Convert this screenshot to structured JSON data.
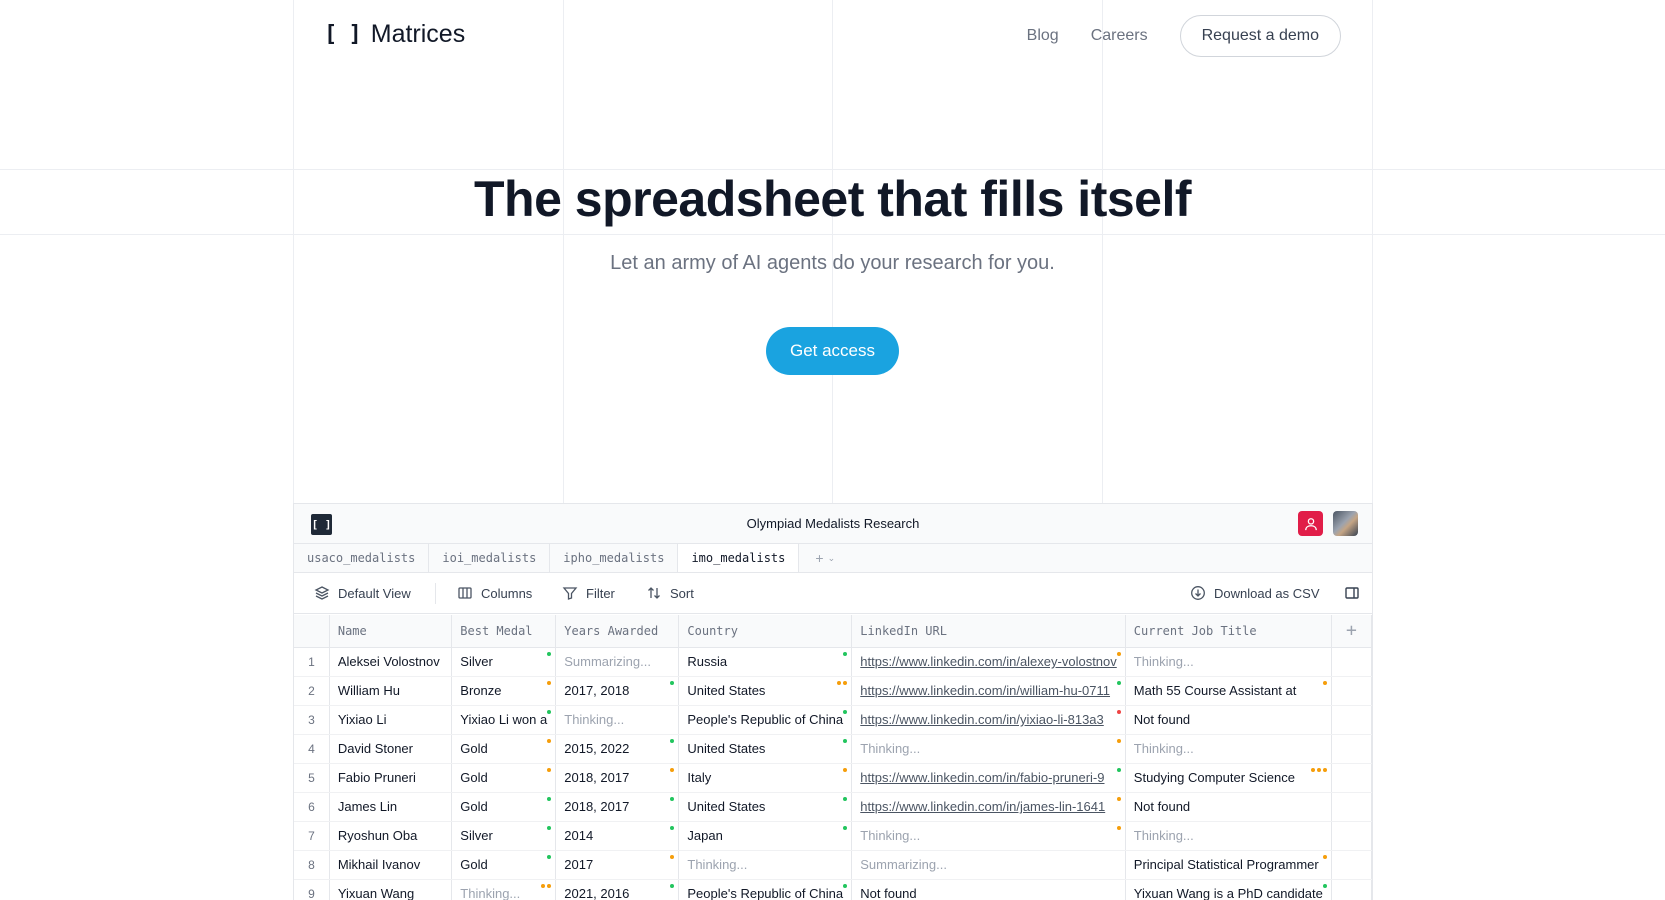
{
  "header": {
    "logo_mark": "[ ]",
    "logo_text": "Matrices",
    "nav": [
      {
        "label": "Blog"
      },
      {
        "label": "Careers"
      }
    ],
    "demo_label": "Request a demo"
  },
  "hero": {
    "title": "The spreadsheet that fills itself",
    "subtitle": "Let an army of AI agents do your research for you.",
    "cta_label": "Get access"
  },
  "app": {
    "logo_mark": "[ ]",
    "title": "Olympiad Medalists Research",
    "tabs": [
      {
        "label": "usaco_medalists"
      },
      {
        "label": "ioi_medalists"
      },
      {
        "label": "ipho_medalists"
      },
      {
        "label": "imo_medalists"
      }
    ],
    "toolbar": {
      "view_label": "Default View",
      "columns_label": "Columns",
      "filter_label": "Filter",
      "sort_label": "Sort",
      "download_label": "Download as CSV"
    },
    "columns": [
      "Name",
      "Best Medal",
      "Years Awarded",
      "Country",
      "LinkedIn URL",
      "Current Job Title"
    ],
    "rows": [
      {
        "idx": "1",
        "cells": [
          "Aleksei Volostnov",
          "Silver",
          "Summarizing...",
          "Russia",
          "https://www.linkedin.com/in/alexey-volostnov",
          "Thinking..."
        ]
      },
      {
        "idx": "2",
        "cells": [
          "William Hu",
          "Bronze",
          "2017, 2018",
          "United States",
          "https://www.linkedin.com/in/william-hu-0711",
          "Math 55 Course Assistant at"
        ]
      },
      {
        "idx": "3",
        "cells": [
          "Yixiao Li",
          "Yixiao Li won a",
          "Thinking...",
          "People's Republic of China",
          "https://www.linkedin.com/in/yixiao-li-813a3",
          "Not found"
        ]
      },
      {
        "idx": "4",
        "cells": [
          "David Stoner",
          "Gold",
          "2015, 2022",
          "United States",
          "Thinking...",
          "Thinking..."
        ]
      },
      {
        "idx": "5",
        "cells": [
          "Fabio Pruneri",
          "Gold",
          "2018, 2017",
          "Italy",
          "https://www.linkedin.com/in/fabio-pruneri-9",
          "Studying Computer Science"
        ]
      },
      {
        "idx": "6",
        "cells": [
          "James Lin",
          "Gold",
          "2018, 2017",
          "United States",
          "https://www.linkedin.com/in/james-lin-1641",
          "Not found"
        ]
      },
      {
        "idx": "7",
        "cells": [
          "Ryoshun Oba",
          "Silver",
          "2014",
          "Japan",
          "Thinking...",
          "Thinking..."
        ]
      },
      {
        "idx": "8",
        "cells": [
          "Mikhail Ivanov",
          "Gold",
          "2017",
          "Thinking...",
          "Summarizing...",
          "Principal Statistical Programmer"
        ]
      },
      {
        "idx": "9",
        "cells": [
          "Yixuan Wang",
          "Thinking...",
          "2021, 2016",
          "People's Republic of China",
          "Not found",
          "Yixuan Wang is a PhD candidate"
        ]
      }
    ],
    "colors": {
      "status_green": "#22c55e",
      "status_orange": "#f59e0b",
      "status_red": "#ef4444",
      "cta_blue": "#1aa3e0",
      "avatar_red": "#e11d48"
    }
  }
}
